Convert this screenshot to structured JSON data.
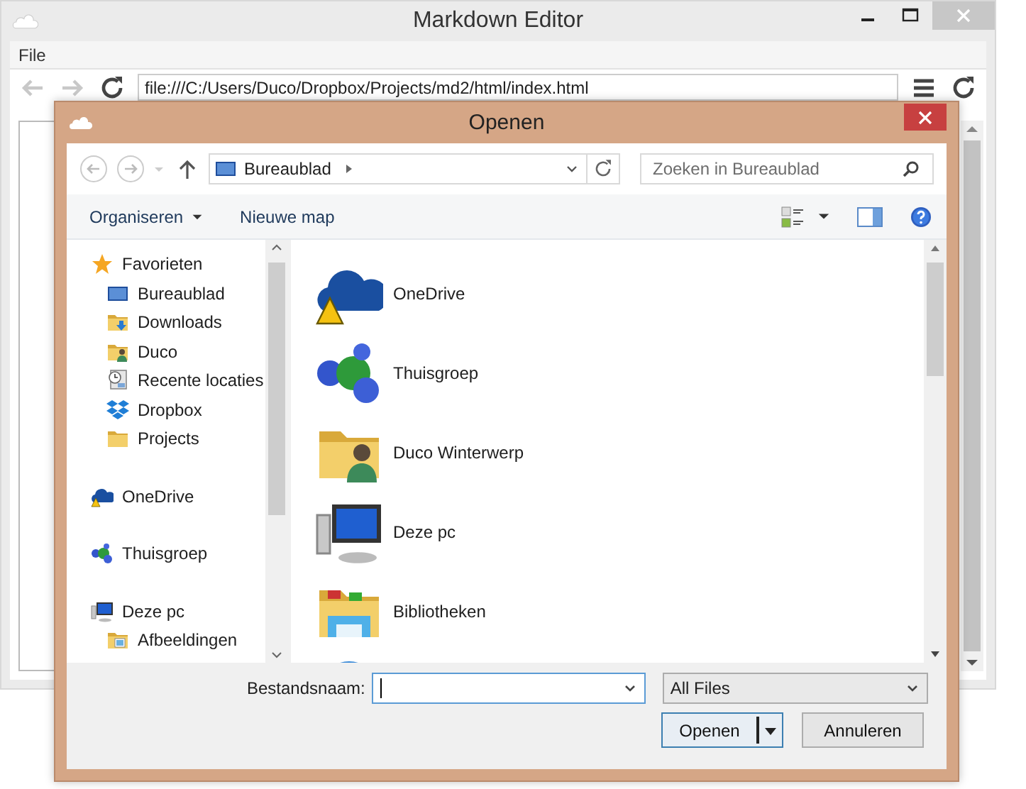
{
  "app_window": {
    "title": "Markdown Editor",
    "menu": [
      "File"
    ],
    "address": "file:///C:/Users/Duco/Dropbox/Projects/md2/html/index.html"
  },
  "dialog": {
    "title": "Openen",
    "location": "Bureaublad",
    "search": {
      "placeholder": "Zoeken in Bureaublad"
    },
    "toolbar": [
      {
        "label": "Organiseren",
        "kind": "menu"
      },
      {
        "label": "Nieuwe map",
        "kind": "button"
      }
    ],
    "nav": [
      {
        "label": "Favorieten",
        "kind": "favorites",
        "selected": false,
        "children": [
          {
            "label": "Bureaublad",
            "kind": "desktop",
            "selected": false
          },
          {
            "label": "Downloads",
            "kind": "download-folder",
            "selected": false
          },
          {
            "label": "Duco",
            "kind": "user-folder",
            "selected": false
          },
          {
            "label": "Recente locaties",
            "kind": "recent",
            "selected": false
          },
          {
            "label": "Dropbox",
            "kind": "box",
            "selected": false
          },
          {
            "label": "Projects",
            "kind": "folder",
            "selected": false
          }
        ]
      },
      {
        "label": "OneDrive",
        "kind": "cloud",
        "selected": false
      },
      {
        "label": "Thuisgroep",
        "kind": "homegroup",
        "selected": false
      },
      {
        "label": "Deze pc",
        "kind": "computer",
        "selected": false,
        "children": [
          {
            "label": "Afbeeldingen",
            "kind": "pictures-folder",
            "selected": false
          }
        ]
      }
    ],
    "items": [
      {
        "label": "OneDrive",
        "kind": "cloud",
        "selected": false
      },
      {
        "label": "Thuisgroep",
        "kind": "homegroup",
        "selected": false
      },
      {
        "label": "Duco Winterwerp",
        "kind": "user-folder",
        "selected": false
      },
      {
        "label": "Deze pc",
        "kind": "computer",
        "selected": false
      },
      {
        "label": "Bibliotheken",
        "kind": "libraries",
        "selected": false
      },
      {
        "kind": "network",
        "selected": false
      }
    ],
    "filename": {
      "label": "Bestandsnaam:"
    },
    "filter": {
      "value": "All Files"
    },
    "buttons": [
      {
        "label": "Openen",
        "kind": "split",
        "default": true
      },
      {
        "label": "Annuleren",
        "kind": "plain",
        "default": false
      }
    ]
  }
}
